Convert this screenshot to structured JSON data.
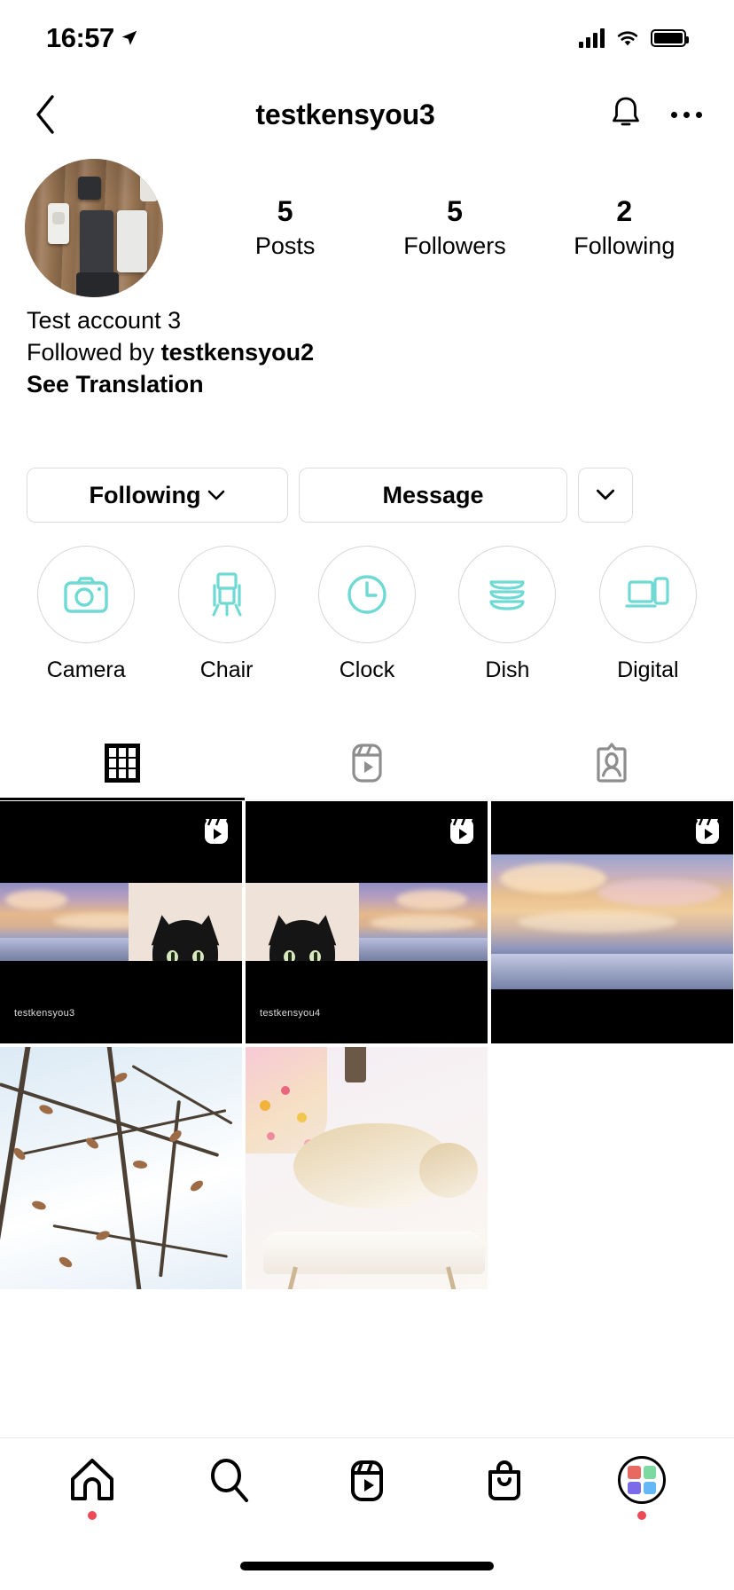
{
  "status_bar": {
    "time": "16:57",
    "location_icon": "location-arrow-icon",
    "signal_icon": "cellular-signal-icon",
    "wifi_icon": "wifi-icon",
    "battery_icon": "battery-full-icon"
  },
  "header": {
    "back_icon": "chevron-left-icon",
    "title": "testkensyou3",
    "notify_icon": "bell-icon",
    "more_icon": "ellipsis-icon"
  },
  "profile": {
    "avatar_name": "profile-avatar",
    "stats": [
      {
        "num": "5",
        "label": "Posts"
      },
      {
        "num": "5",
        "label": "Followers"
      },
      {
        "num": "2",
        "label": "Following"
      }
    ],
    "bio_name": "Test account 3",
    "followed_by_prefix": "Followed by ",
    "followed_by_user": "testkensyou2",
    "see_translation": "See Translation"
  },
  "actions": {
    "following_label": "Following",
    "message_label": "Message",
    "more_icon": "chevron-down-icon"
  },
  "highlights": [
    {
      "label": "Camera",
      "icon": "camera-icon"
    },
    {
      "label": "Chair",
      "icon": "easel-chair-icon"
    },
    {
      "label": "Clock",
      "icon": "clock-icon"
    },
    {
      "label": "Dish",
      "icon": "dish-stack-icon"
    },
    {
      "label": "Digital",
      "icon": "digital-devices-icon"
    }
  ],
  "tabs": [
    {
      "name": "grid",
      "icon": "grid-icon",
      "active": true
    },
    {
      "name": "reels",
      "icon": "reels-icon",
      "active": false
    },
    {
      "name": "tagged",
      "icon": "tagged-icon",
      "active": false
    }
  ],
  "posts": [
    {
      "type": "reel",
      "watermark": "testkensyou3",
      "content": "black-cat-sunset-video"
    },
    {
      "type": "reel",
      "watermark": "testkensyou4",
      "content": "black-cat-sunset-video"
    },
    {
      "type": "reel",
      "watermark": "",
      "content": "sunset-ocean-video"
    },
    {
      "type": "photo",
      "watermark": "",
      "content": "bare-tree-branches-sky"
    },
    {
      "type": "photo",
      "watermark": "",
      "content": "sleeping-ginger-cat"
    }
  ],
  "bottom_nav": [
    {
      "name": "home",
      "icon": "home-icon",
      "badge": true
    },
    {
      "name": "search",
      "icon": "search-icon",
      "badge": false
    },
    {
      "name": "reels",
      "icon": "reels-icon",
      "badge": false
    },
    {
      "name": "shop",
      "icon": "shop-bag-icon",
      "badge": false
    },
    {
      "name": "profile",
      "icon": "profile-avatar-icon",
      "badge": true
    }
  ],
  "colors": {
    "highlight_icon": "#6FD9D4",
    "badge_red": "#ED4956",
    "border_gray": "#dcdcdc",
    "inactive_gray": "#8e8e8e"
  }
}
